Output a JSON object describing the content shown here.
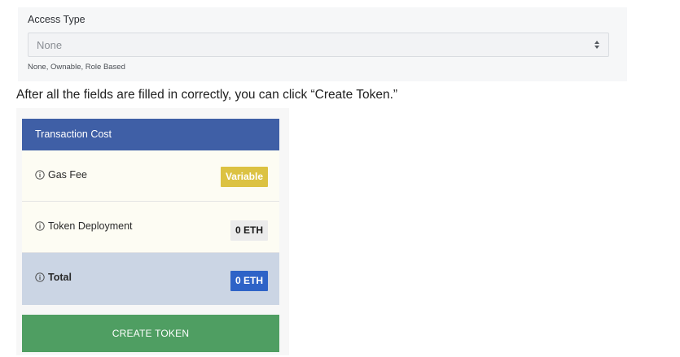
{
  "access_type": {
    "label": "Access Type",
    "selected_value": "None",
    "hint": "None, Ownable, Role Based"
  },
  "instruction_text": "After all the fields are filled in correctly, you can click “Create Token.”",
  "transaction_cost": {
    "header": "Transaction Cost",
    "rows": [
      {
        "label": "Gas Fee",
        "value": "Variable"
      },
      {
        "label": "Token Deployment",
        "value": "0 ETH"
      },
      {
        "label": "Total",
        "value": "0 ETH"
      }
    ],
    "button_label": "CREATE TOKEN"
  },
  "colors": {
    "header_blue": "#3f5fa6",
    "variable_badge": "#dcc242",
    "total_badge": "#2e63c7",
    "total_row_bg": "#cbd5e4",
    "create_button": "#4f9e62"
  },
  "icons": {
    "select_arrow": "sort-arrows-icon",
    "row_info": "info-icon"
  }
}
